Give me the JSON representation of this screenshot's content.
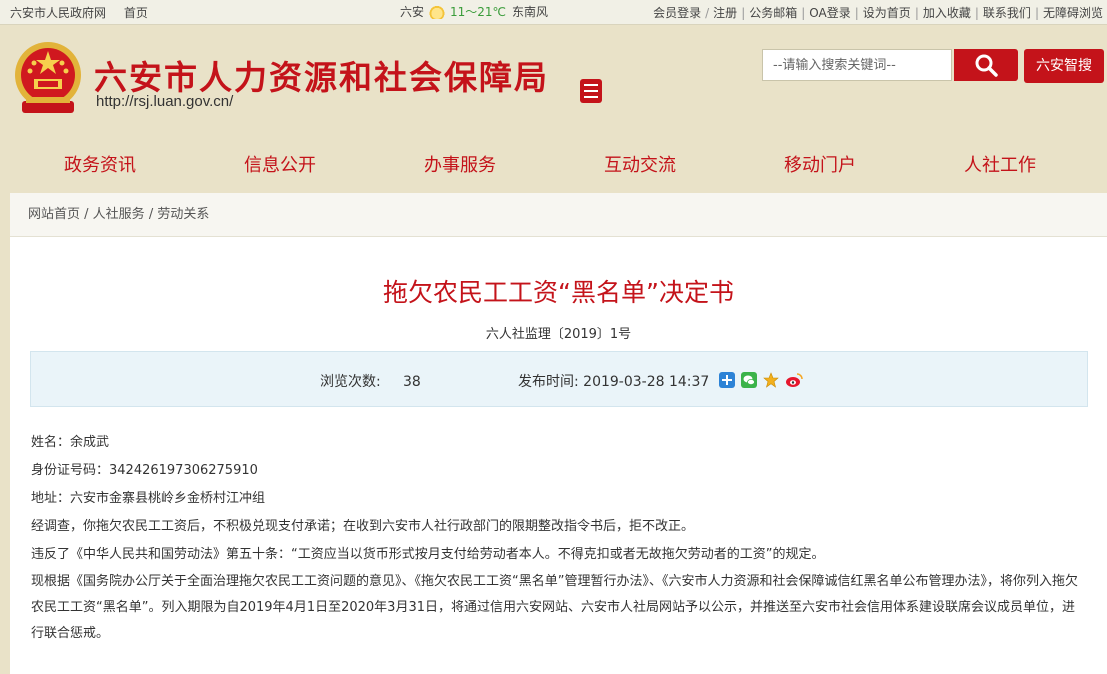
{
  "topbar": {
    "left_links": [
      "六安市人民政府网",
      "首页"
    ],
    "weather": {
      "city": "六安",
      "temp": "11～21℃",
      "wind": "东南风"
    },
    "right_links": [
      "会员登录",
      "注册",
      "公务邮箱",
      "OA登录",
      "设为首页",
      "加入收藏",
      "联系我们",
      "无障碍浏览"
    ]
  },
  "header": {
    "title": "六安市人力资源和社会保障局",
    "url": "http://rsj.luan.gov.cn/",
    "search_placeholder": "--请输入搜索关键词--",
    "smart_search": "六安智搜"
  },
  "nav": [
    "政务资讯",
    "信息公开",
    "办事服务",
    "互动交流",
    "移动门户",
    "人社工作"
  ],
  "breadcrumb": [
    "网站首页",
    "人社服务",
    "劳动关系"
  ],
  "article": {
    "title": "拖欠农民工工资“黑名单”决定书",
    "doc_no": "六人社监理〔2019〕1号",
    "views_label": "浏览次数:",
    "views": "38",
    "date_label": "发布时间:",
    "date": "2019-03-28 14:37",
    "paragraphs": [
      "姓名：余成武",
      "身份证号码：342426197306275910",
      "地址：六安市金寨县桃岭乡金桥村江冲组",
      "经调查，你拖欠农民工工资后，不积极兑现支付承诺；在收到六安市人社行政部门的限期整改指令书后，拒不改正。",
      "违反了《中华人民共和国劳动法》第五十条：“工资应当以货币形式按月支付给劳动者本人。不得克扣或者无故拖欠劳动者的工资”的规定。",
      "现根据《国务院办公厅关于全面治理拖欠农民工工资问题的意见》、《拖欠农民工工资“黑名单”管理暂行办法》、《六安市人力资源和社会保障诚信红黑名单公布管理办法》，将你列入拖欠农民工工资“黑名单”。列入期限为自2019年4月1日至2020年3月31日，将通过信用六安网站、六安市人社局网站予以公示，并推送至六安市社会信用体系建设联席会议成员单位，进行联合惩戒。"
    ]
  },
  "colors": {
    "accent": "#c4131a",
    "meta_bg": "#eaf4f9",
    "page_bg": "#e9e2c8"
  },
  "icons": [
    "national-emblem-icon",
    "seal-icon",
    "sun-icon",
    "search-icon",
    "share-plus-icon",
    "wechat-icon",
    "favorite-star-icon",
    "weibo-icon"
  ]
}
